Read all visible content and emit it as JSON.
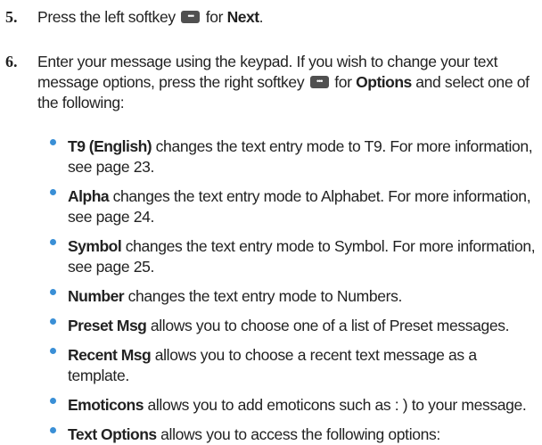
{
  "step5": {
    "number": "5.",
    "before": "Press the left softkey",
    "mid": "for",
    "term": "Next",
    "end": "."
  },
  "step6": {
    "number": "6.",
    "text_a": "Enter your message using the keypad. If you wish to change your text message options, press the right softkey",
    "mid": "for",
    "term": "Options",
    "text_b": "and select one of the following:"
  },
  "options": [
    {
      "term": "T9 (English)",
      "desc": "changes the text entry mode to T9. For more information, see page 23."
    },
    {
      "term": "Alpha",
      "desc": "changes the text entry mode to Alphabet. For more information, see page 24."
    },
    {
      "term": "Symbol",
      "desc": "changes the text entry mode to Symbol. For more information, see page 25."
    },
    {
      "term": "Number",
      "desc": "changes the text entry mode to Numbers."
    },
    {
      "term": "Preset Msg",
      "desc": "allows you to choose one of a list of Preset messages."
    },
    {
      "term": "Recent Msg",
      "desc": "allows you to choose a recent text message as a template."
    },
    {
      "term": "Emoticons",
      "desc": "allows you to add emoticons such as : ) to your message."
    },
    {
      "term": "Text Options",
      "desc": "allows you to access the following options:"
    }
  ],
  "colors": {
    "text": "#222222",
    "bullet": "#3a8fd6",
    "softkey": "#505050"
  },
  "icons": {
    "softkey": "softkey-icon",
    "bullet": "bullet-icon"
  }
}
